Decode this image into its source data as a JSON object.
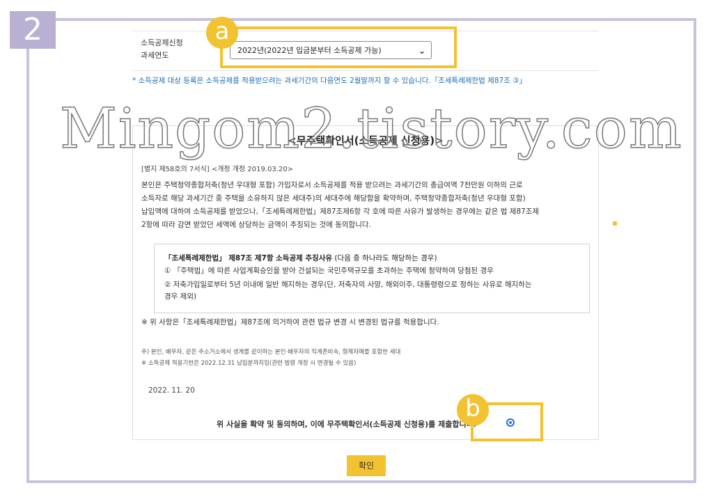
{
  "step": "2",
  "year_field": {
    "label_line1": "소득공제신청",
    "label_line2": "과세연도",
    "selected": "2022년(2022년 입금분부터 소득공제 가능)"
  },
  "notice": "* 소득공제 대상 등록은 소득공제를 적용받으려는 과세기간의 다음연도 2월말까지 할 수 있습니다.「조세특례제한법 제87조 ③」",
  "watermark": "Mingom2.tistory.com",
  "document": {
    "title": "<무주택확인서(소득공제 신청용)>",
    "form_ref": "[별지 제58호의 7서식] <개정 개정 2019.03.20>",
    "body_lines": [
      "본인은 주택청약종합저축(청년 우대형 포함) 가입자로서 소득공제를 적용 받으려는 과세기간의 총급여액 7천만원 이하의 근로",
      "소득자로 해당 과세기간 중 주택을 소유하지 않은 세대주)의 세대주에 해당함을 확약하며, 주택청약종합저축(청년 우대형 포함)",
      "납입액에 대하여 소득공제를 받았으나,「조세특례제한법」제87조제6항 각 호에 따른 사유가 발생하는 경우에는 같은 법 제87조제",
      "2항에 따라 감면 받았던 세액에 상당하는 금액이 추징되는 것에 동의합니다."
    ],
    "recap": {
      "heading_bold": "「조세특례제한법」 제87조 제7항 소득공제 추징사유",
      "heading_rest": " (다음 중 하나라도 해당하는 경우)",
      "item1": "① 「주택법」에 따른 사업계획승인을 받아 건설되는 국민주택규모를 초과하는 주택에 청약하여 당첨된 경우",
      "item2": "② 저축가입일로부터 5년 이내에 일반 해지하는 경우(단, 저축자의 사망, 해외이주, 대통령령으로 정하는 사유로 해지하는",
      "item2_cont": "경우 제외)"
    },
    "law_note": "※ 위 사항은「조세특례제한법」제87조에 의거하여 관련 법규 변경 시 변경된 법규를 적용합니다.",
    "footnote1": "주) 본인, 배우자, 같은 주소거소에서 생계를 같이하는 본인·배우자의 직계존비속, 형제자매를 포함한 세대",
    "footnote2": "※ 소득공제 적용기한은 2022.12.31 납입분까지임(관련 법령 개정 시 변경될 수 있음)",
    "date": "2022. 11. 20",
    "agree_text": "위 사실을 확약 및 동의하며, 이에 무주택확인서(소득공제 신청용)를 제출합니다."
  },
  "annotations": {
    "a": "a",
    "b": "b"
  },
  "confirm_label": "확인",
  "colors": {
    "highlight": "#f2c230",
    "frame": "#c9c2dc",
    "badge": "#b9b0d3",
    "notice": "#1b6fb3",
    "radio": "#1e6fe0"
  }
}
